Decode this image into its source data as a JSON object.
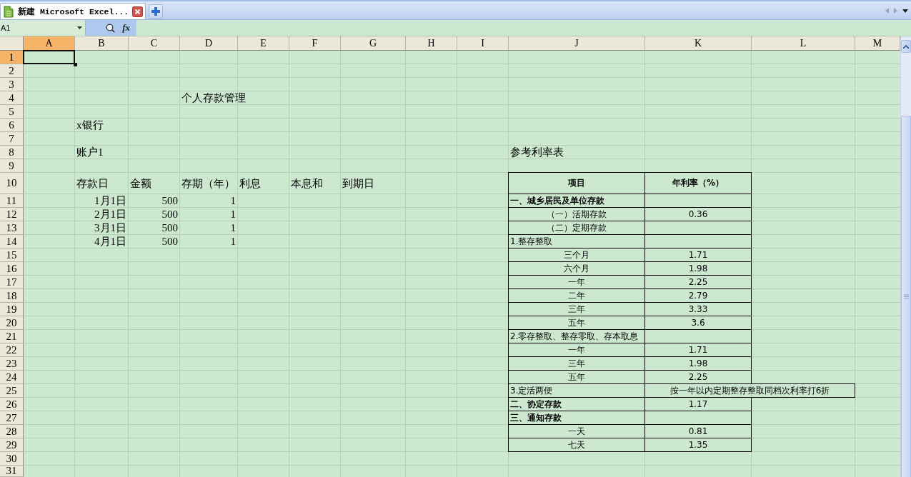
{
  "tab_bar": {
    "tabs": [
      {
        "title": "新建 Microsoft Excel...",
        "selected": true
      }
    ]
  },
  "formula_bar": {
    "name_box": "A1",
    "function_button": "fx"
  },
  "sheet": {
    "columns": [
      {
        "label": "A",
        "selected": true
      },
      {
        "label": "B",
        "selected": false
      },
      {
        "label": "C",
        "selected": false
      },
      {
        "label": "D",
        "selected": false
      },
      {
        "label": "E",
        "selected": false
      },
      {
        "label": "F",
        "selected": false
      },
      {
        "label": "G",
        "selected": false
      },
      {
        "label": "H",
        "selected": false
      },
      {
        "label": "I",
        "selected": false
      },
      {
        "label": "J",
        "selected": false
      },
      {
        "label": "K",
        "selected": false
      },
      {
        "label": "L",
        "selected": false
      },
      {
        "label": "M",
        "selected": false
      }
    ],
    "rows": [
      {
        "label": "1",
        "selected": true
      },
      {
        "label": "2",
        "selected": false
      },
      {
        "label": "3",
        "selected": false
      },
      {
        "label": "4",
        "selected": false,
        "cells": {
          "D": {
            "kind": "text",
            "text": "个人存款管理"
          }
        }
      },
      {
        "label": "5",
        "selected": false
      },
      {
        "label": "6",
        "selected": false,
        "cells": {
          "B": {
            "kind": "text",
            "text": "x银行"
          }
        }
      },
      {
        "label": "7",
        "selected": false
      },
      {
        "label": "8",
        "selected": false,
        "cells": {
          "B": {
            "kind": "text",
            "text": "账户1"
          },
          "J": {
            "kind": "text",
            "text": "参考利率表"
          }
        }
      },
      {
        "label": "9",
        "selected": false
      },
      {
        "label": "10",
        "selected": false,
        "cells": {
          "B": {
            "kind": "text",
            "text": "存款日"
          },
          "C": {
            "kind": "text",
            "text": "金额"
          },
          "D": {
            "kind": "text",
            "text": "存期（年）"
          },
          "E": {
            "kind": "text",
            "text": "利息"
          },
          "F": {
            "kind": "text",
            "text": "本息和"
          },
          "G": {
            "kind": "text",
            "text": "到期日"
          },
          "J": {
            "kind": "table_header",
            "text": "项目"
          },
          "K": {
            "kind": "table_header",
            "text": "年利率（%）"
          }
        }
      },
      {
        "label": "11",
        "selected": false,
        "cells": {
          "B": {
            "kind": "number",
            "text": "1月1日"
          },
          "C": {
            "kind": "number",
            "text": "500"
          },
          "D": {
            "kind": "number",
            "text": "1"
          },
          "J": {
            "kind": "table_heading",
            "text": "一、城乡居民及单位存款"
          },
          "K": {
            "kind": "table_item"
          }
        }
      },
      {
        "label": "12",
        "selected": false,
        "cells": {
          "B": {
            "kind": "number",
            "text": "2月1日"
          },
          "C": {
            "kind": "number",
            "text": "500"
          },
          "D": {
            "kind": "number",
            "text": "1"
          },
          "J": {
            "kind": "table_item",
            "text": "（一）活期存款"
          },
          "K": {
            "kind": "table_item",
            "text": "0.36"
          }
        }
      },
      {
        "label": "13",
        "selected": false,
        "cells": {
          "B": {
            "kind": "number",
            "text": "3月1日"
          },
          "C": {
            "kind": "number",
            "text": "500"
          },
          "D": {
            "kind": "number",
            "text": "1"
          },
          "J": {
            "kind": "table_item",
            "text": "（二）定期存款"
          },
          "K": {
            "kind": "table_item"
          }
        }
      },
      {
        "label": "14",
        "selected": false,
        "cells": {
          "B": {
            "kind": "number",
            "text": "4月1日"
          },
          "C": {
            "kind": "number",
            "text": "500"
          },
          "D": {
            "kind": "number",
            "text": "1"
          },
          "J": {
            "kind": "table_label",
            "text": "1.整存整取"
          },
          "K": {
            "kind": "table_item"
          }
        }
      },
      {
        "label": "15",
        "selected": false,
        "cells": {
          "J": {
            "kind": "table_item",
            "text": "三个月"
          },
          "K": {
            "kind": "table_item",
            "text": "1.71"
          }
        }
      },
      {
        "label": "16",
        "selected": false,
        "cells": {
          "J": {
            "kind": "table_item",
            "text": "六个月"
          },
          "K": {
            "kind": "table_item",
            "text": "1.98"
          }
        }
      },
      {
        "label": "17",
        "selected": false,
        "cells": {
          "J": {
            "kind": "table_item",
            "text": "一年"
          },
          "K": {
            "kind": "table_item",
            "text": "2.25"
          }
        }
      },
      {
        "label": "18",
        "selected": false,
        "cells": {
          "J": {
            "kind": "table_item",
            "text": "二年"
          },
          "K": {
            "kind": "table_item",
            "text": "2.79"
          }
        }
      },
      {
        "label": "19",
        "selected": false,
        "cells": {
          "J": {
            "kind": "table_item",
            "text": "三年"
          },
          "K": {
            "kind": "table_item",
            "text": "3.33"
          }
        }
      },
      {
        "label": "20",
        "selected": false,
        "cells": {
          "J": {
            "kind": "table_item",
            "text": "五年"
          },
          "K": {
            "kind": "table_item",
            "text": "3.6"
          }
        }
      },
      {
        "label": "21",
        "selected": false,
        "cells": {
          "J": {
            "kind": "table_label",
            "text": "2.零存整取、整存零取、存本取息"
          },
          "K": {
            "kind": "table_item"
          }
        }
      },
      {
        "label": "22",
        "selected": false,
        "cells": {
          "J": {
            "kind": "table_item",
            "text": "一年"
          },
          "K": {
            "kind": "table_item",
            "text": "1.71"
          }
        }
      },
      {
        "label": "23",
        "selected": false,
        "cells": {
          "J": {
            "kind": "table_item",
            "text": "三年"
          },
          "K": {
            "kind": "table_item",
            "text": "1.98"
          }
        }
      },
      {
        "label": "24",
        "selected": false,
        "cells": {
          "J": {
            "kind": "table_item",
            "text": "五年"
          },
          "K": {
            "kind": "table_item",
            "text": "2.25"
          }
        }
      },
      {
        "label": "25",
        "selected": false,
        "cells": {
          "J": {
            "kind": "table_label",
            "text": "3.定活两便"
          },
          "K": {
            "kind": "table_item",
            "merged": true,
            "text": "按一年以内定期整存整取同档次利率打6折"
          }
        }
      },
      {
        "label": "26",
        "selected": false,
        "cells": {
          "J": {
            "kind": "table_heading",
            "text": "二、协定存款"
          },
          "K": {
            "kind": "table_item",
            "text": "1.17"
          }
        }
      },
      {
        "label": "27",
        "selected": false,
        "cells": {
          "J": {
            "kind": "table_heading",
            "text": "三、通知存款"
          },
          "K": {
            "kind": "table_item"
          }
        }
      },
      {
        "label": "28",
        "selected": false,
        "cells": {
          "J": {
            "kind": "table_item",
            "text": "一天"
          },
          "K": {
            "kind": "table_item",
            "text": "0.81"
          }
        }
      },
      {
        "label": "29",
        "selected": false,
        "cells": {
          "J": {
            "kind": "table_item",
            "text": "七天"
          },
          "K": {
            "kind": "table_item",
            "text": "1.35"
          }
        }
      },
      {
        "label": "30",
        "selected": false
      },
      {
        "label": "31",
        "selected": false
      }
    ]
  }
}
